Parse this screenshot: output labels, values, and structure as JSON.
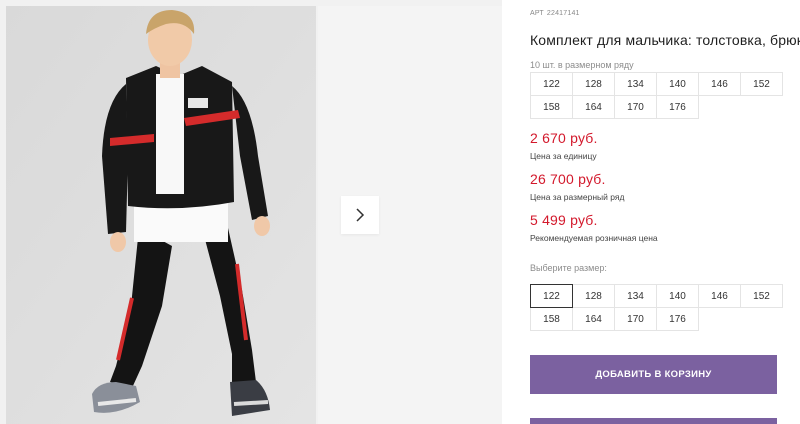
{
  "product": {
    "sku_label": "АРТ",
    "sku_value": "22417141",
    "title": "Комплект для мальчика: толстовка, брюки"
  },
  "pack": {
    "caption": "10 шт. в размерном ряду",
    "sizes": [
      "122",
      "128",
      "134",
      "140",
      "146",
      "152",
      "158",
      "164",
      "170",
      "176"
    ]
  },
  "prices": [
    {
      "value": "2 670 руб.",
      "label": "Цена за единицу"
    },
    {
      "value": "26 700 руб.",
      "label": "Цена за размерный ряд"
    },
    {
      "value": "5 499 руб.",
      "label": "Рекомендуемая розничная цена"
    }
  ],
  "size_select": {
    "caption": "Выберите размер:",
    "sizes": [
      "122",
      "128",
      "134",
      "140",
      "146",
      "152",
      "158",
      "164",
      "170",
      "176"
    ],
    "selected": "122"
  },
  "actions": {
    "add_to_cart": "ДОБАВИТЬ В КОРЗИНУ"
  },
  "icons": {
    "next": "chevron-right-icon"
  },
  "colors": {
    "price": "#d3192c",
    "accent": "#7b61a0",
    "gallery_bg": "#f1f1f1"
  }
}
